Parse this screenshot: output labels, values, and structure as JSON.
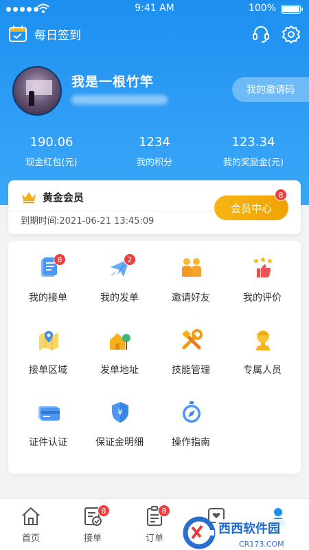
{
  "status_bar": {
    "time": "9:41 AM",
    "battery": "100%"
  },
  "header": {
    "checkin_label": "每日签到"
  },
  "profile": {
    "name": "我是一根竹竿",
    "invite_label": "我的邀请码"
  },
  "stats": [
    {
      "value": "190.06",
      "label": "现金红包(元)"
    },
    {
      "value": "1234",
      "label": "我的积分"
    },
    {
      "value": "123.34",
      "label": "我的奖励金(元)"
    }
  ],
  "vip": {
    "title": "黄金会员",
    "expiry": "到期时间:2021-06-21 13:45:09",
    "button": "会员中心",
    "badge": "8"
  },
  "grid": [
    {
      "label": "我的接单",
      "icon": "receive-order-icon",
      "badge": "8"
    },
    {
      "label": "我的发单",
      "icon": "send-order-icon",
      "badge": "2"
    },
    {
      "label": "邀请好友",
      "icon": "invite-friends-icon"
    },
    {
      "label": "我的评价",
      "icon": "review-icon"
    },
    {
      "label": "接单区域",
      "icon": "area-map-icon"
    },
    {
      "label": "发单地址",
      "icon": "address-icon"
    },
    {
      "label": "技能管理",
      "icon": "skills-icon"
    },
    {
      "label": "专属人员",
      "icon": "dedicated-staff-icon"
    },
    {
      "label": "证件认证",
      "icon": "id-card-icon"
    },
    {
      "label": "保证金明细",
      "icon": "deposit-shield-icon"
    },
    {
      "label": "操作指南",
      "icon": "compass-icon"
    }
  ],
  "tabs": [
    {
      "label": "首页",
      "icon": "home-icon"
    },
    {
      "label": "接单",
      "icon": "receive-tab-icon",
      "badge": "8"
    },
    {
      "label": "订单",
      "icon": "orders-tab-icon",
      "badge": "8"
    }
  ],
  "watermark": {
    "brand": "西西软件园",
    "url": "CR173.COM"
  },
  "colors": {
    "primary": "#1c8ff0",
    "gold": "#f3ac0a",
    "badge": "#ef3e3e"
  }
}
